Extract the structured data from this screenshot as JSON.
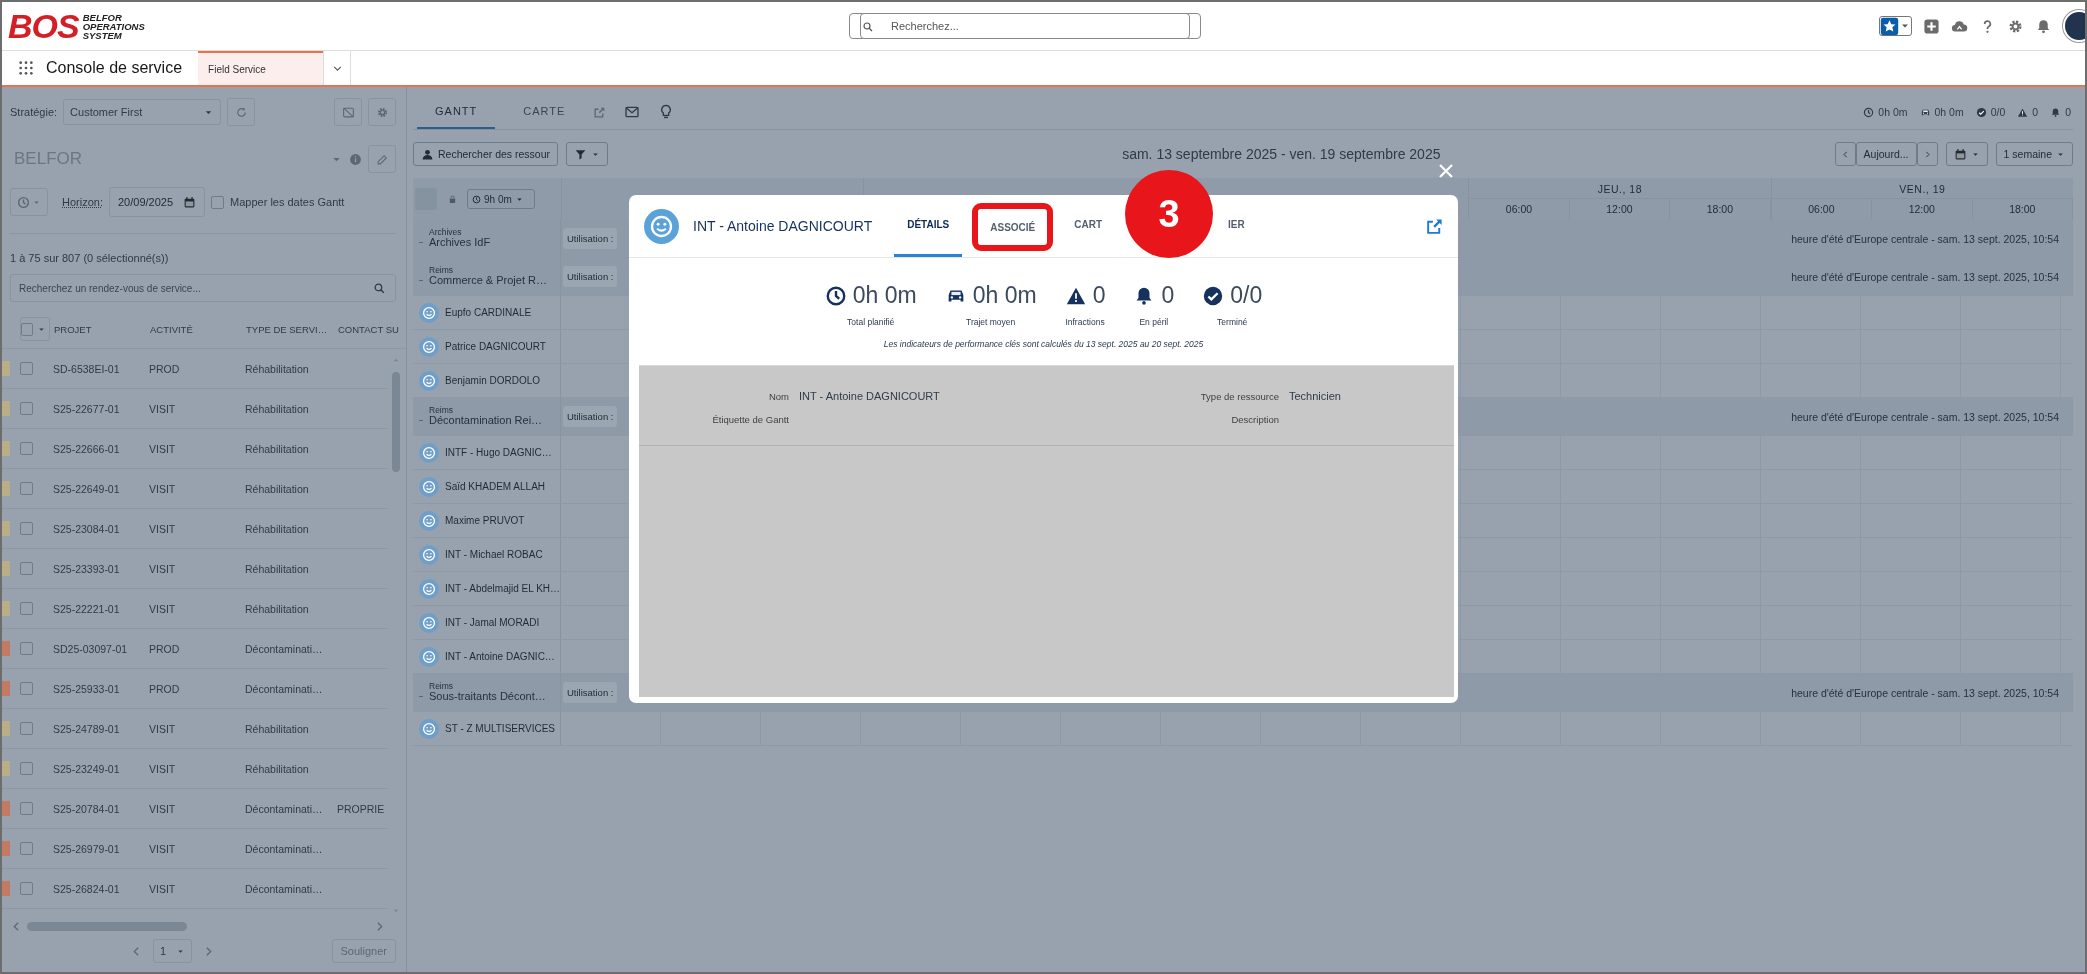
{
  "header": {
    "logo": {
      "mark": "BOS",
      "lines": [
        "BELFOR",
        "OPERATIONS",
        "SYSTEM"
      ]
    },
    "search": {
      "placeholder": "Recherchez..."
    }
  },
  "nav": {
    "app_name": "Console de service",
    "tabs": [
      {
        "label": "Field Service",
        "selected": true
      }
    ]
  },
  "sidebar": {
    "strategy": {
      "label": "Stratégie:",
      "value": "Customer First"
    },
    "title": "BELFOR",
    "horizon": {
      "label": "Horizon:",
      "value": "20/09/2025"
    },
    "map_dates": {
      "label": "Mapper les dates Gantt",
      "checked": false
    },
    "count": "1 à 75 sur 807 (0 sélectionné(s))",
    "search": {
      "placeholder": "Recherchez un rendez-vous de service..."
    },
    "table": {
      "select_all": {
        "checked": false
      },
      "columns": [
        "PROJET",
        "ACTIVITÉ",
        "TYPE DE SERVI…",
        "CONTACT SU"
      ],
      "rows": [
        {
          "color": "#b9ae88",
          "checked": false,
          "cells": [
            "SD-6538EI-01",
            "PROD",
            "Réhabilitation"
          ]
        },
        {
          "color": "#b9ae88",
          "checked": false,
          "cells": [
            "S25-22677-01",
            "VISIT",
            "Réhabilitation"
          ]
        },
        {
          "color": "#b9ae88",
          "checked": false,
          "cells": [
            "S25-22666-01",
            "VISIT",
            "Réhabilitation"
          ]
        },
        {
          "color": "#b9ae88",
          "checked": false,
          "cells": [
            "S25-22649-01",
            "VISIT",
            "Réhabilitation"
          ]
        },
        {
          "color": "#b9ae88",
          "checked": false,
          "cells": [
            "S25-23084-01",
            "VISIT",
            "Réhabilitation"
          ]
        },
        {
          "color": "#b9ae88",
          "checked": false,
          "cells": [
            "S25-23393-01",
            "VISIT",
            "Réhabilitation"
          ]
        },
        {
          "color": "#b9ae88",
          "checked": false,
          "cells": [
            "S25-22221-01",
            "VISIT",
            "Réhabilitation"
          ]
        },
        {
          "color": "#c27a62",
          "checked": false,
          "cells": [
            "SD25-03097-01",
            "PROD",
            "Décontaminati…"
          ]
        },
        {
          "color": "#c27a62",
          "checked": false,
          "cells": [
            "S25-25933-01",
            "PROD",
            "Décontaminati…"
          ]
        },
        {
          "color": "#b9ae88",
          "checked": false,
          "cells": [
            "S25-24789-01",
            "VISIT",
            "Réhabilitation"
          ]
        },
        {
          "color": "#b9ae88",
          "checked": false,
          "cells": [
            "S25-23249-01",
            "VISIT",
            "Réhabilitation"
          ]
        },
        {
          "color": "#c27a62",
          "checked": false,
          "cells": [
            "S25-20784-01",
            "VISIT",
            "Décontaminati…",
            "PROPRIE"
          ]
        },
        {
          "color": "#c27a62",
          "checked": false,
          "cells": [
            "S25-26979-01",
            "VISIT",
            "Décontaminati…"
          ]
        },
        {
          "color": "#c27a62",
          "checked": false,
          "cells": [
            "S25-26824-01",
            "VISIT",
            "Décontaminati…"
          ]
        }
      ]
    },
    "pager": {
      "page": "1",
      "button": "Souligner"
    }
  },
  "gantt": {
    "tabs": [
      {
        "label": "GANTT",
        "selected": true
      },
      {
        "label": "CARTE",
        "selected": false
      }
    ],
    "kpis": [
      {
        "kind": "clock",
        "value": "0h 0m"
      },
      {
        "kind": "car",
        "value": "0h 0m"
      },
      {
        "kind": "check",
        "value": "0/0"
      },
      {
        "kind": "warning",
        "value": "0"
      },
      {
        "kind": "bell",
        "value": "0"
      }
    ],
    "resource_search": "Rechercher des ressour",
    "date_range": "sam. 13 septembre 2025 - ven. 19 septembre 2025",
    "today": "Aujourd...",
    "view": "1 semaine",
    "duration": "9h 0m",
    "days": [
      {
        "label": "JEU., 18",
        "times": [
          "06:00",
          "12:00",
          "18:00"
        ]
      },
      {
        "label": "VEN., 19",
        "times": [
          "06:00",
          "12:00",
          "18:00"
        ]
      }
    ],
    "rows": [
      {
        "kind": "group",
        "region": "Archives",
        "name": "Archives IdF",
        "utilisation": "Utilisation :",
        "timezone": "heure d'été d'Europe centrale - sam. 13 sept. 2025, 10:54"
      },
      {
        "kind": "group",
        "region": "Reims",
        "name": "Commerce & Projet R…",
        "utilisation": "Utilisation :",
        "timezone": "heure d'été d'Europe centrale - sam. 13 sept. 2025, 10:54"
      },
      {
        "kind": "resource",
        "name": "Eupfo CARDINALE"
      },
      {
        "kind": "resource",
        "name": "Patrice DAGNICOURT"
      },
      {
        "kind": "resource",
        "name": "Benjamin DORDOLO"
      },
      {
        "kind": "group",
        "region": "Reims",
        "name": "Décontamination Rei…",
        "utilisation": "Utilisation :",
        "timezone": "heure d'été d'Europe centrale - sam. 13 sept. 2025, 10:54"
      },
      {
        "kind": "resource",
        "name": "INTF - Hugo DAGNIC…"
      },
      {
        "kind": "resource",
        "name": "Saïd KHADEM ALLAH"
      },
      {
        "kind": "resource",
        "name": "Maxime PRUVOT"
      },
      {
        "kind": "resource",
        "name": "INT - Michael ROBAC"
      },
      {
        "kind": "resource",
        "name": "INT - Abdelmajid EL KH…"
      },
      {
        "kind": "resource",
        "name": "INT - Jamal MORADI"
      },
      {
        "kind": "resource",
        "name": "INT - Antoine DAGNIC…"
      },
      {
        "kind": "group",
        "region": "Reims",
        "name": "Sous-traitants Décont…",
        "utilisation": "Utilisation :",
        "timezone": "heure d'été d'Europe centrale - sam. 13 sept. 2025, 10:54"
      },
      {
        "kind": "resource",
        "name": "ST - Z MULTISERVICES"
      }
    ]
  },
  "modal": {
    "title": "INT - Antoine DAGNICOURT",
    "tabs": [
      {
        "label": "DÉTAILS",
        "selected": true,
        "highlighted": false
      },
      {
        "label": "ASSOCIÉ",
        "selected": false,
        "highlighted": true
      },
      {
        "label": "CART",
        "selected": false,
        "highlighted": false
      },
      {
        "label": "IER",
        "selected": false,
        "highlighted": false
      }
    ],
    "kpis": [
      {
        "kind": "clock",
        "value": "0h 0m",
        "label": "Total planifié"
      },
      {
        "kind": "car",
        "value": "0h 0m",
        "label": "Trajet moyen"
      },
      {
        "kind": "warning",
        "value": "0",
        "label": "Infractions"
      },
      {
        "kind": "bell",
        "value": "0",
        "label": "En péril"
      },
      {
        "kind": "check",
        "value": "0/0",
        "label": "Terminé"
      }
    ],
    "note": "Les indicateurs de performance clés sont calculés du 13 sept. 2025 au 20 sept. 2025",
    "fields": [
      {
        "label": "Nom",
        "value": "INT - Antoine DAGNICOURT"
      },
      {
        "label": "Type de ressource",
        "value": "Technicien"
      },
      {
        "label": "Étiquette de Gantt"
      },
      {
        "label": "Description"
      }
    ]
  },
  "annotation": {
    "number": "3"
  }
}
